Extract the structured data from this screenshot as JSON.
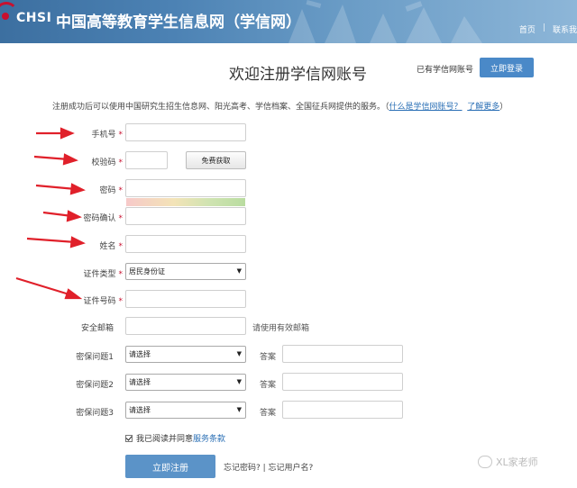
{
  "header": {
    "logo_text": "CHSI",
    "site_title": "中国高等教育学生信息网（学信网）",
    "links": [
      "首页",
      "联系我"
    ]
  },
  "page": {
    "title": "欢迎注册学信网账号",
    "has_account_text": "已有学信网账号",
    "login_button": "立即登录",
    "intro_text": "注册成功后可以使用中国研究生招生信息网、阳光高考、学信档案、全国征兵网提供的服务。（",
    "intro_link1": "什么是学信网账号？",
    "intro_link2": "了解更多",
    "intro_end": "）"
  },
  "form": {
    "phone_label": "手机号",
    "code_label": "校验码",
    "code_button": "免费获取",
    "password_label": "密码",
    "confirm_label": "密码确认",
    "name_label": "姓名",
    "id_type_label": "证件类型",
    "id_type_value": "居民身份证",
    "id_number_label": "证件号码",
    "email_label": "安全邮箱",
    "email_hint": "请使用有效邮箱",
    "q1_label": "密保问题1",
    "q2_label": "密保问题2",
    "q3_label": "密保问题3",
    "select_placeholder": "请选择",
    "answer_label": "答案",
    "required_mark": "*",
    "agree_text": "我已阅读并同意",
    "agree_link": "服务条款",
    "submit": "立即注册",
    "forgot": "忘记密码? | 忘记用户名?"
  },
  "watermark": "XL家老师",
  "colors": {
    "header": "#4c82b4",
    "accent": "#4a89c8",
    "required": "#c8102e",
    "arrow": "#e0202a"
  }
}
